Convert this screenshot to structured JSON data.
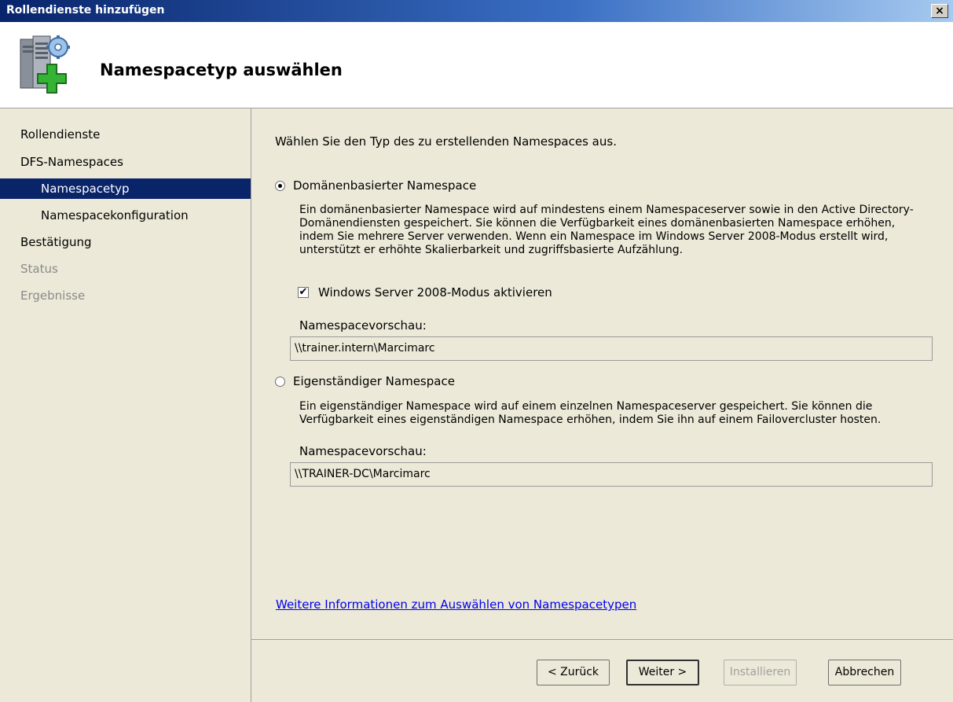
{
  "window": {
    "title": "Rollendienste hinzufügen",
    "close_symbol": "×"
  },
  "header": {
    "title": "Namespacetyp auswählen",
    "icon": "server-add-icon"
  },
  "nav": {
    "items": [
      {
        "label": "Rollendienste",
        "level": 0,
        "state": "normal"
      },
      {
        "label": "DFS-Namespaces",
        "level": 0,
        "state": "normal"
      },
      {
        "label": "Namespacetyp",
        "level": 1,
        "state": "selected"
      },
      {
        "label": "Namespacekonfiguration",
        "level": 1,
        "state": "normal"
      },
      {
        "label": "Bestätigung",
        "level": 0,
        "state": "normal"
      },
      {
        "label": "Status",
        "level": 0,
        "state": "disabled"
      },
      {
        "label": "Ergebnisse",
        "level": 0,
        "state": "disabled"
      }
    ]
  },
  "main": {
    "instruction": "Wählen Sie den Typ des zu erstellenden Namespaces aus.",
    "domain_option": {
      "label": "Domänenbasierter Namespace",
      "selected": true,
      "description": "Ein domänenbasierter Namespace wird auf mindestens einem Namespaceserver sowie in den Active Directory-Domänendiensten gespeichert. Sie können die Verfügbarkeit eines domänenbasierten Namespace erhöhen, indem Sie mehrere Server verwenden. Wenn ein Namespace im Windows Server 2008-Modus erstellt wird, unterstützt er erhöhte Skalierbarkeit und zugriffsbasierte Aufzählung.",
      "checkbox_label": "Windows Server 2008-Modus aktivieren",
      "checkbox_checked": true,
      "preview_label": "Namespacevorschau:",
      "preview_value": "\\\\trainer.intern\\Marcimarc"
    },
    "standalone_option": {
      "label": "Eigenständiger Namespace",
      "selected": false,
      "description": "Ein eigenständiger Namespace wird auf einem einzelnen Namespaceserver gespeichert. Sie können die Verfügbarkeit eines eigenständigen Namespace erhöhen, indem Sie ihn auf einem Failovercluster hosten.",
      "preview_label": "Namespacevorschau:",
      "preview_value": "\\\\TRAINER-DC\\Marcimarc"
    },
    "info_link": "Weitere Informationen zum Auswählen von Namespacetypen"
  },
  "buttons": {
    "back": "< Zurück",
    "next": "Weiter >",
    "install": "Installieren",
    "cancel": "Abbrechen"
  },
  "colors": {
    "selection": "#0a246a",
    "panel": "#ece9d8",
    "link": "#0000ee"
  }
}
